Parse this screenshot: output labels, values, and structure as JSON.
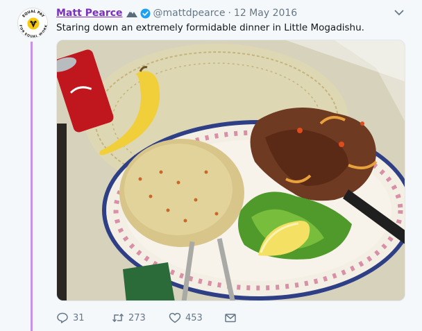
{
  "tweet": {
    "display_name": "Matt Pearce",
    "handle": "@mattdpearce",
    "separator": "·",
    "date": "12 May 2016",
    "text": "Staring down an extremely formidable dinner in Little Mogadishu.",
    "avatar_text_top": "EQUAL PAY",
    "avatar_text_bottom": "FOR EQUAL WORK"
  },
  "actions": {
    "replies": "31",
    "retweets": "273",
    "likes": "453"
  },
  "icons": {
    "avatar": "equal-pay-badge",
    "name_emoji": "mountain-icon",
    "verified": "verified-badge-icon",
    "menu": "chevron-down-icon",
    "reply": "reply-icon",
    "retweet": "retweet-icon",
    "like": "heart-icon",
    "message": "envelope-icon"
  },
  "colors": {
    "name": "#7b2fbe",
    "thread_line": "#c792ea",
    "verified": "#1da1f2",
    "muted": "#657786"
  }
}
